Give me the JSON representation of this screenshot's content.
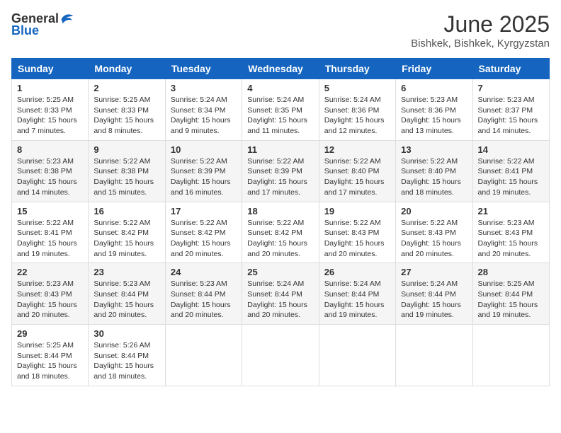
{
  "header": {
    "logo_general": "General",
    "logo_blue": "Blue",
    "title": "June 2025",
    "subtitle": "Bishkek, Bishkek, Kyrgyzstan"
  },
  "days_of_week": [
    "Sunday",
    "Monday",
    "Tuesday",
    "Wednesday",
    "Thursday",
    "Friday",
    "Saturday"
  ],
  "weeks": [
    [
      {
        "day": "1",
        "sunrise": "5:25 AM",
        "sunset": "8:33 PM",
        "daylight": "15 hours and 7 minutes."
      },
      {
        "day": "2",
        "sunrise": "5:25 AM",
        "sunset": "8:33 PM",
        "daylight": "15 hours and 8 minutes."
      },
      {
        "day": "3",
        "sunrise": "5:24 AM",
        "sunset": "8:34 PM",
        "daylight": "15 hours and 9 minutes."
      },
      {
        "day": "4",
        "sunrise": "5:24 AM",
        "sunset": "8:35 PM",
        "daylight": "15 hours and 11 minutes."
      },
      {
        "day": "5",
        "sunrise": "5:24 AM",
        "sunset": "8:36 PM",
        "daylight": "15 hours and 12 minutes."
      },
      {
        "day": "6",
        "sunrise": "5:23 AM",
        "sunset": "8:36 PM",
        "daylight": "15 hours and 13 minutes."
      },
      {
        "day": "7",
        "sunrise": "5:23 AM",
        "sunset": "8:37 PM",
        "daylight": "15 hours and 14 minutes."
      }
    ],
    [
      {
        "day": "8",
        "sunrise": "5:23 AM",
        "sunset": "8:38 PM",
        "daylight": "15 hours and 14 minutes."
      },
      {
        "day": "9",
        "sunrise": "5:22 AM",
        "sunset": "8:38 PM",
        "daylight": "15 hours and 15 minutes."
      },
      {
        "day": "10",
        "sunrise": "5:22 AM",
        "sunset": "8:39 PM",
        "daylight": "15 hours and 16 minutes."
      },
      {
        "day": "11",
        "sunrise": "5:22 AM",
        "sunset": "8:39 PM",
        "daylight": "15 hours and 17 minutes."
      },
      {
        "day": "12",
        "sunrise": "5:22 AM",
        "sunset": "8:40 PM",
        "daylight": "15 hours and 17 minutes."
      },
      {
        "day": "13",
        "sunrise": "5:22 AM",
        "sunset": "8:40 PM",
        "daylight": "15 hours and 18 minutes."
      },
      {
        "day": "14",
        "sunrise": "5:22 AM",
        "sunset": "8:41 PM",
        "daylight": "15 hours and 19 minutes."
      }
    ],
    [
      {
        "day": "15",
        "sunrise": "5:22 AM",
        "sunset": "8:41 PM",
        "daylight": "15 hours and 19 minutes."
      },
      {
        "day": "16",
        "sunrise": "5:22 AM",
        "sunset": "8:42 PM",
        "daylight": "15 hours and 19 minutes."
      },
      {
        "day": "17",
        "sunrise": "5:22 AM",
        "sunset": "8:42 PM",
        "daylight": "15 hours and 20 minutes."
      },
      {
        "day": "18",
        "sunrise": "5:22 AM",
        "sunset": "8:42 PM",
        "daylight": "15 hours and 20 minutes."
      },
      {
        "day": "19",
        "sunrise": "5:22 AM",
        "sunset": "8:43 PM",
        "daylight": "15 hours and 20 minutes."
      },
      {
        "day": "20",
        "sunrise": "5:22 AM",
        "sunset": "8:43 PM",
        "daylight": "15 hours and 20 minutes."
      },
      {
        "day": "21",
        "sunrise": "5:23 AM",
        "sunset": "8:43 PM",
        "daylight": "15 hours and 20 minutes."
      }
    ],
    [
      {
        "day": "22",
        "sunrise": "5:23 AM",
        "sunset": "8:43 PM",
        "daylight": "15 hours and 20 minutes."
      },
      {
        "day": "23",
        "sunrise": "5:23 AM",
        "sunset": "8:44 PM",
        "daylight": "15 hours and 20 minutes."
      },
      {
        "day": "24",
        "sunrise": "5:23 AM",
        "sunset": "8:44 PM",
        "daylight": "15 hours and 20 minutes."
      },
      {
        "day": "25",
        "sunrise": "5:24 AM",
        "sunset": "8:44 PM",
        "daylight": "15 hours and 20 minutes."
      },
      {
        "day": "26",
        "sunrise": "5:24 AM",
        "sunset": "8:44 PM",
        "daylight": "15 hours and 19 minutes."
      },
      {
        "day": "27",
        "sunrise": "5:24 AM",
        "sunset": "8:44 PM",
        "daylight": "15 hours and 19 minutes."
      },
      {
        "day": "28",
        "sunrise": "5:25 AM",
        "sunset": "8:44 PM",
        "daylight": "15 hours and 19 minutes."
      }
    ],
    [
      {
        "day": "29",
        "sunrise": "5:25 AM",
        "sunset": "8:44 PM",
        "daylight": "15 hours and 18 minutes."
      },
      {
        "day": "30",
        "sunrise": "5:26 AM",
        "sunset": "8:44 PM",
        "daylight": "15 hours and 18 minutes."
      },
      null,
      null,
      null,
      null,
      null
    ]
  ],
  "labels": {
    "sunrise": "Sunrise:",
    "sunset": "Sunset:",
    "daylight": "Daylight:"
  }
}
